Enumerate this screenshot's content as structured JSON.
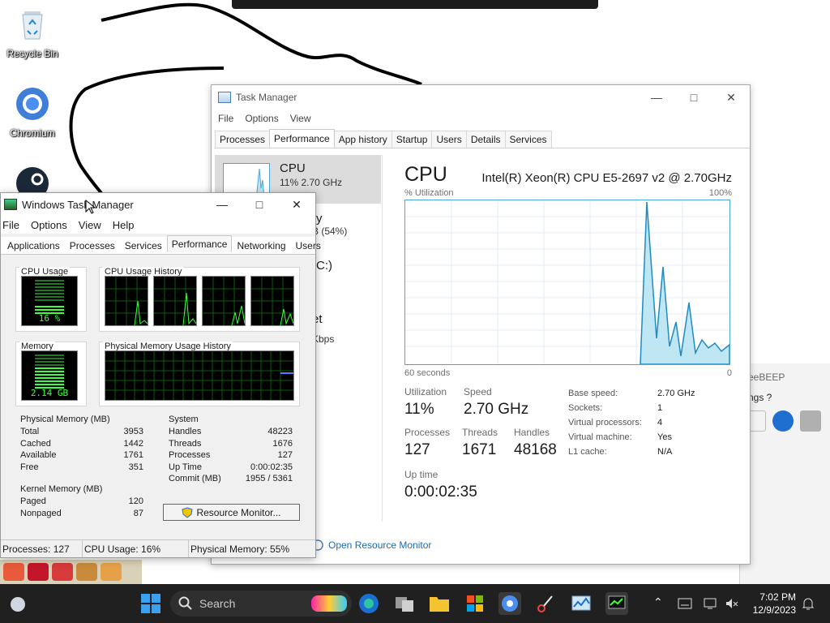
{
  "desktop": {
    "icons": [
      {
        "label": "Recycle Bin",
        "icon": "recycle-bin-icon"
      },
      {
        "label": "Chromium",
        "icon": "chromium-icon"
      },
      {
        "label": "",
        "icon": "steam-icon"
      }
    ],
    "background_window": {
      "title": "eeBEEP",
      "menu": "ngs  ?"
    }
  },
  "task_manager": {
    "title": "Task Manager",
    "menu": [
      "File",
      "Options",
      "View"
    ],
    "tabs": [
      "Processes",
      "Performance",
      "App history",
      "Startup",
      "Users",
      "Details",
      "Services"
    ],
    "active_tab": "Performance",
    "sidebar": [
      {
        "name": "CPU",
        "sub": "11%  2.70 GHz"
      },
      {
        "name": "ry",
        "sub": "B (54%)"
      },
      {
        "name": "(C:)",
        "sub": ""
      },
      {
        "name": "et",
        "sub": "Kbps"
      }
    ],
    "cpu": {
      "heading": "CPU",
      "model": "Intel(R) Xeon(R) CPU E5-2697 v2 @ 2.70GHz",
      "util_label": "% Utilization",
      "max_label": "100%",
      "time_label": "60 seconds",
      "min_label": "0",
      "stats": {
        "utilization_label": "Utilization",
        "utilization": "11%",
        "speed_label": "Speed",
        "speed": "2.70 GHz",
        "processes_label": "Processes",
        "processes": "127",
        "threads_label": "Threads",
        "threads": "1671",
        "handles_label": "Handles",
        "handles": "48168",
        "uptime_label": "Up time",
        "uptime": "0:00:02:35"
      },
      "specs": [
        {
          "k": "Base speed:",
          "v": "2.70 GHz"
        },
        {
          "k": "Sockets:",
          "v": "1"
        },
        {
          "k": "Virtual processors:",
          "v": "4"
        },
        {
          "k": "Virtual machine:",
          "v": "Yes"
        },
        {
          "k": "L1 cache:",
          "v": "N/A"
        }
      ],
      "open_resource_monitor": "Open Resource Monitor"
    }
  },
  "classic_tm": {
    "title": "Windows Task Manager",
    "menu": [
      "File",
      "Options",
      "View",
      "Help"
    ],
    "tabs": [
      "Applications",
      "Processes",
      "Services",
      "Performance",
      "Networking",
      "Users"
    ],
    "active_tab": "Performance",
    "cpu_usage_label": "CPU Usage",
    "cpu_usage_value": "16 %",
    "cpu_history_label": "CPU Usage History",
    "memory_label": "Memory",
    "memory_value": "2.14 GB",
    "mem_history_label": "Physical Memory Usage History",
    "physical_memory": {
      "label": "Physical Memory (MB)",
      "rows": [
        {
          "k": "Total",
          "v": "3953"
        },
        {
          "k": "Cached",
          "v": "1442"
        },
        {
          "k": "Available",
          "v": "1761"
        },
        {
          "k": "Free",
          "v": "351"
        }
      ]
    },
    "kernel_memory": {
      "label": "Kernel Memory (MB)",
      "rows": [
        {
          "k": "Paged",
          "v": "120"
        },
        {
          "k": "Nonpaged",
          "v": "87"
        }
      ]
    },
    "system": {
      "label": "System",
      "rows": [
        {
          "k": "Handles",
          "v": "48223"
        },
        {
          "k": "Threads",
          "v": "1676"
        },
        {
          "k": "Processes",
          "v": "127"
        },
        {
          "k": "Up Time",
          "v": "0:00:02:35"
        },
        {
          "k": "Commit (MB)",
          "v": "1955 / 5361"
        }
      ]
    },
    "resource_monitor_button": "Resource Monitor...",
    "status": {
      "processes": "Processes: 127",
      "cpu": "CPU Usage: 16%",
      "memory": "Physical Memory: 55%"
    }
  },
  "taskbar": {
    "search_placeholder": "Search",
    "time": "7:02 PM",
    "date": "12/9/2023"
  },
  "colors": {
    "accent_blue": "#4aa6d6",
    "graph_fill": "#bfe6f3",
    "meter_green": "#3cff3c",
    "taskbar": "#202020"
  }
}
